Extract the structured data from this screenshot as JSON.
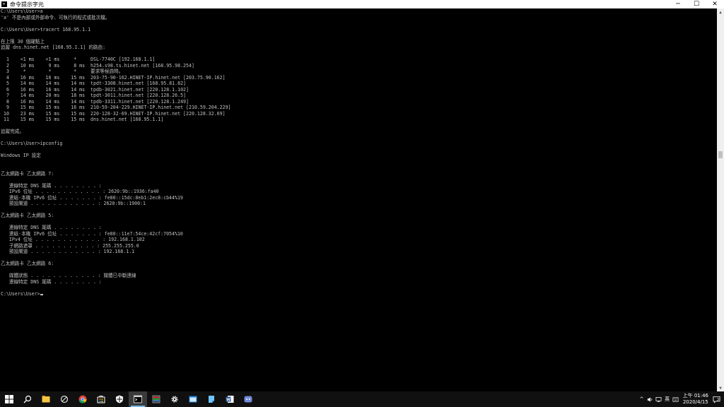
{
  "window": {
    "title": "命令提示字元",
    "controls": {
      "minimize": "─",
      "maximize": "☐",
      "close": "✕"
    }
  },
  "console": {
    "lines": [
      "C:\\Users\\User>a",
      "'a' 不是內部或外部命令、可執行的程式或批次檔。",
      "",
      "C:\\Users\\User>tracert 168.95.1.1",
      "",
      "在上限 30 個躍點上",
      "追蹤 dns.hinet.net [168.95.1.1] 的路由:",
      "",
      "  1    <1 ms    <1 ms     *     DSL-7740C [192.168.1.1]",
      "  2    10 ms     9 ms     8 ms  h254.s98.ts.hinet.net [168.95.98.254]",
      "  3     *        *        *     要求等候逾時。",
      "  4    16 ms    16 ms    15 ms  203-75-90-162.HINET-IP.hinet.net [203.75.90.162]",
      "  5    14 ms    14 ms    14 ms  tpdt-3308.hinet.net [168.95.81.82]",
      "  6    16 ms    16 ms    14 ms  tpdb-3021.hinet.net [220.128.1.102]",
      "  7    14 ms    20 ms    18 ms  tpdt-3011.hinet.net [220.128.26.5]",
      "  8    16 ms    14 ms    14 ms  tpdb-3311.hinet.net [220.128.1.249]",
      "  9    15 ms    15 ms    16 ms  210-59-204-229.HINET-IP.hinet.net [210.59.204.229]",
      " 10    23 ms    15 ms    15 ms  220-128-32-69.HINET-IP.hinet.net [220.128.32.69]",
      " 11    15 ms    15 ms    15 ms  dns.hinet.net [168.95.1.1]",
      "",
      "追蹤完成。",
      "",
      "C:\\Users\\User>ipconfig",
      "",
      "Windows IP 設定",
      "",
      "",
      "乙太網路卡 乙太網路 7:",
      "",
      "   連線特定 DNS 尾碼 . . . . . . . . :",
      "   IPv6 位址 . . . . . . . . . . . . : 2620:9b::1936:fa40",
      "   連結-本機 IPv6 位址 . . . . . . . : fe80::15dc:8eb1:2ec8:cb44%19",
      "   預設閘道 . . . . . . . . . . . . : 2620:9b::1900:1",
      "",
      "乙太網路卡 乙太網路 5:",
      "",
      "   連線特定 DNS 尾碼 . . . . . . . . :",
      "   連結-本機 IPv6 位址 . . . . . . . : fe80::11e7:54ce:42cf:7054%10",
      "   IPv4 位址 . . . . . . . . . . . . : 192.168.1.102",
      "   子網路遮罩 . . . . . . . . . . . : 255.255.255.0",
      "   預設閘道 . . . . . . . . . . . . : 192.168.1.1",
      "",
      "乙太網路卡 乙太網路 6:",
      "",
      "   媒體狀態 . . . . . . . . . . . . : 媒體已中斷連線",
      "   連線特定 DNS 尾碼 . . . . . . . . :",
      ""
    ],
    "prompt": "C:\\Users\\User>"
  },
  "taskbar": {
    "apps": [
      {
        "name": "start-icon"
      },
      {
        "name": "search-icon"
      },
      {
        "name": "file-explorer-icon"
      },
      {
        "name": "app-icon"
      },
      {
        "name": "chrome-icon"
      },
      {
        "name": "store-icon"
      },
      {
        "name": "security-icon"
      },
      {
        "name": "command-prompt-icon"
      },
      {
        "name": "media-icon"
      },
      {
        "name": "settings-icon"
      },
      {
        "name": "app-window-icon"
      },
      {
        "name": "notes-icon"
      },
      {
        "name": "word-icon"
      },
      {
        "name": "discord-icon"
      }
    ],
    "tray": {
      "ime": "英",
      "time": "上午 01:46",
      "date": "2020/4/15",
      "notification_count": "2"
    }
  }
}
